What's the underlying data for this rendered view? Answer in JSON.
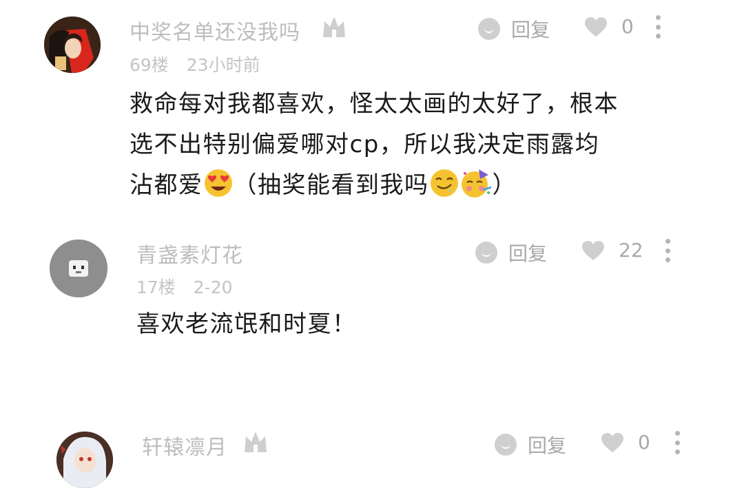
{
  "comments": [
    {
      "username": "中奖名单还没我吗",
      "floor": "69楼",
      "time": "23小时前",
      "reply_label": "回复",
      "likes": "0",
      "content_line1": "救命每对我都喜欢，怪太太画的太好了，根本",
      "content_line2": "选不出特别偏爱哪对cp，所以我决定雨露均",
      "content_line3a": "沾都爱",
      "content_line3b": "（抽奖能看到我吗",
      "content_line3c": "）",
      "emojis": [
        "heart-eyes-emoji",
        "drooling-face-emoji",
        "partying-face-emoji"
      ]
    },
    {
      "username": "青盏素灯花",
      "floor": "17楼",
      "time": "2-20",
      "reply_label": "回复",
      "likes": "22",
      "content_line1": "喜欢老流氓和时夏！"
    },
    {
      "username": "轩辕凛月",
      "reply_label": "回复",
      "likes": "0"
    }
  ],
  "colors": {
    "username": "#bdbdbd",
    "meta": "#c4c4c4",
    "action": "#a8a8a8",
    "content": "#1a1a1a"
  }
}
